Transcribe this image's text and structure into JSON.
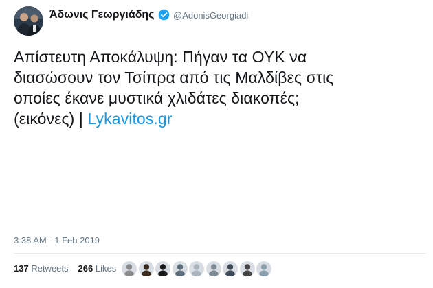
{
  "author": {
    "name": "Άδωνις Γεωργιάδης",
    "handle": "@AdonisGeorgiadi",
    "verified": true,
    "avatar_icon": "profile-photo-icon"
  },
  "tweet": {
    "lines": [
      "Απίστευτη Αποκάλυψη: Πήγαν τα ΟΥΚ να",
      "διασώσουν τον Τσίπρα από τις Μαλδίβες στις",
      "οποίες έκανε μυστικά χλιδάτες διακοπές;"
    ],
    "last_line_prefix": "(εικόνες) | ",
    "link_text": "Lykavitos.gr",
    "timestamp": "3:38 AM - 1 Feb 2019"
  },
  "stats": {
    "retweets_count": "137",
    "retweets_label": "Retweets",
    "likes_count": "266",
    "likes_label": "Likes"
  },
  "colors": {
    "text": "#14171a",
    "secondary": "#657786",
    "link": "#1b95e0",
    "verified_badge": "#1da1f2",
    "divider": "#e6ecf0"
  },
  "likers": [
    {
      "icon": "liker-avatar-1-icon",
      "color": "#8a8a8a"
    },
    {
      "icon": "liker-avatar-2-icon",
      "color": "#3a2a1e"
    },
    {
      "icon": "liker-avatar-3-icon",
      "color": "#1a1a1a"
    },
    {
      "icon": "liker-avatar-4-icon",
      "color": "#5b6c7a"
    },
    {
      "icon": "liker-avatar-5-icon",
      "color": "#a9b4bd"
    },
    {
      "icon": "liker-avatar-6-icon",
      "color": "#7f8b94"
    },
    {
      "icon": "liker-avatar-7-icon",
      "color": "#3d4a55"
    },
    {
      "icon": "liker-avatar-8-icon",
      "color": "#454545"
    },
    {
      "icon": "liker-avatar-9-icon",
      "color": "#8aa0ad"
    }
  ]
}
